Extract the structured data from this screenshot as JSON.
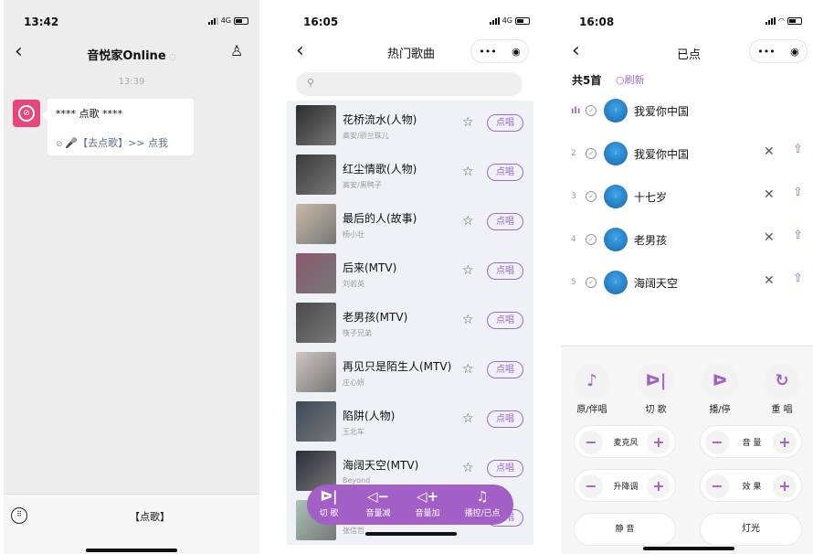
{
  "panel1": {
    "time": "13:42",
    "network": "4G",
    "title": "音悦家Online",
    "timestamp": "13:39",
    "message_line1": "**** 点歌 ****",
    "message_line2": "🎤【去点歌】>> 点我",
    "bottom_button": "【点歌】"
  },
  "panel2": {
    "time": "16:05",
    "network": "4G",
    "title": "热门歌曲",
    "pick_label": "点唱",
    "songs": [
      {
        "title": "花桥流水(人物)",
        "singer": "高安/骄兰珠儿"
      },
      {
        "title": "红尘情歌(人物)",
        "singer": "高安/黑鸭子"
      },
      {
        "title": "最后的人(故事)",
        "singer": "杨小壮"
      },
      {
        "title": "后来(MTV)",
        "singer": "刘若英"
      },
      {
        "title": "老男孩(MTV)",
        "singer": "筷子兄弟"
      },
      {
        "title": "再见只是陌生人(MTV)",
        "singer": "庄心妍"
      },
      {
        "title": "陷阱(人物)",
        "singer": "王北车"
      },
      {
        "title": "海阔天空(MTV)",
        "singer": "Beyond"
      },
      {
        "title": "",
        "singer": "张信哲"
      }
    ],
    "controls": [
      {
        "icon": "ᐅ|",
        "label": "切 歌"
      },
      {
        "icon": "◁−",
        "label": "音量减"
      },
      {
        "icon": "◁+",
        "label": "音量加"
      },
      {
        "icon": "♫",
        "label": "播控/已点"
      }
    ]
  },
  "panel3": {
    "time": "16:08",
    "title": "已点",
    "count": "共5首",
    "refresh": "刷新",
    "queue": [
      {
        "num": "",
        "name": "我爱你中国"
      },
      {
        "num": "2",
        "name": "我爱你中国"
      },
      {
        "num": "3",
        "name": "十七岁"
      },
      {
        "num": "4",
        "name": "老男孩"
      },
      {
        "num": "5",
        "name": "海阔天空"
      }
    ],
    "buttons": [
      {
        "icon": "♪",
        "label": "原/伴唱"
      },
      {
        "icon": "ᐅ|",
        "label": "切 歌"
      },
      {
        "icon": "ᐅ",
        "label": "播/停"
      },
      {
        "icon": "↻",
        "label": "重 唱"
      }
    ],
    "adjusters": [
      {
        "label": "麦克风"
      },
      {
        "label": "音 量"
      },
      {
        "label": "升降调"
      },
      {
        "label": "效 果"
      }
    ],
    "mute": "静 音",
    "light": "灯光"
  },
  "colors": {
    "accent": "#a260c6",
    "row_bg": "#eef1f6",
    "chat_bg": "#ededed"
  }
}
